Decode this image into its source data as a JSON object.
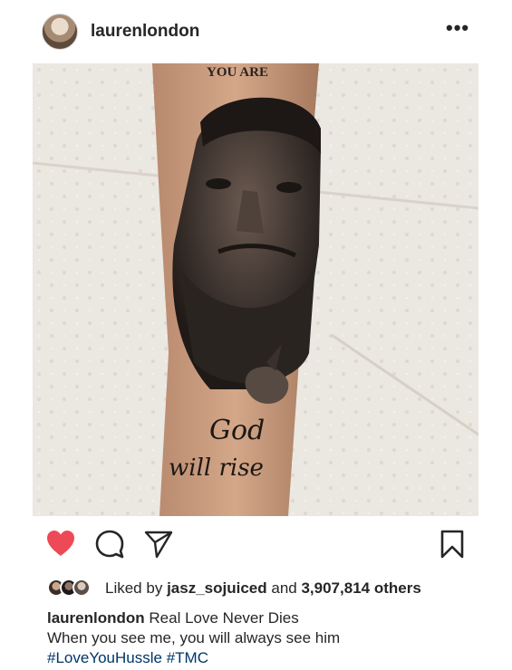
{
  "post": {
    "username": "laurenlondon",
    "more_label": "•••",
    "likes": {
      "prefix": "Liked by",
      "liker": "jasz_sojuiced",
      "conjunction": "and",
      "count": "3,907,814",
      "suffix": "others"
    },
    "caption": {
      "username": "laurenlondon",
      "line1": "Real Love Never Dies",
      "line2": "When you see me, you will always see him",
      "hashtag1": "#LoveYouHussle",
      "hashtag2": "#TMC"
    },
    "photo": {
      "tattoo_text_top": "YOU ARE",
      "tattoo_text_line1": "God",
      "tattoo_text_line2": "will rise"
    },
    "liked": true
  },
  "icons": {
    "like": "heart-icon",
    "comment": "comment-icon",
    "share": "paper-plane-icon",
    "save": "bookmark-icon",
    "more": "more-icon"
  },
  "colors": {
    "heart": "#ed4956",
    "hashtag": "#003569",
    "text": "#262626"
  }
}
